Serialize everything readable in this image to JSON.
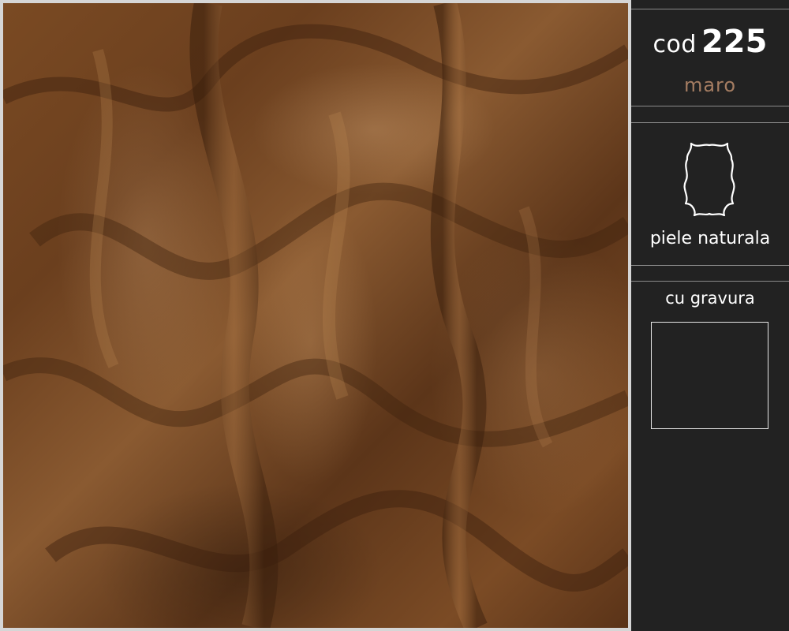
{
  "product": {
    "code_prefix": "cod",
    "code_number": "225",
    "color_name": "maro",
    "material": "piele naturala",
    "engraving_label": "cu gravura"
  },
  "icons": {
    "material": "leather-hide-icon"
  },
  "colors": {
    "panel_background": "#222222",
    "color_name_text": "#a57d62",
    "leather": "#7a4a23"
  }
}
